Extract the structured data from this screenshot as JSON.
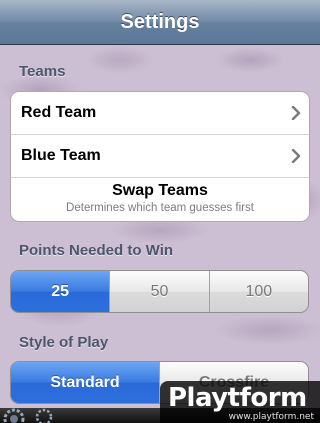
{
  "nav": {
    "title": "Settings"
  },
  "teams": {
    "header": "Teams",
    "red_team_label": "Red Team",
    "blue_team_label": "Blue Team",
    "swap_title": "Swap Teams",
    "swap_subtitle": "Determines which team guesses first"
  },
  "points": {
    "header": "Points Needed to Win",
    "options": [
      "25",
      "50",
      "100"
    ],
    "selected": "25"
  },
  "style": {
    "header": "Style of Play",
    "options": [
      "Standard",
      "Crossfire"
    ],
    "selected": "Standard"
  },
  "watermark": {
    "logo": "Playtform",
    "url": "www.playtform.net"
  },
  "colors": {
    "accent": "#2c6fdc",
    "nav_bar": "#6680a0",
    "background": "#cdbfd3",
    "section_header": "#4c566c"
  },
  "icons": {
    "disclosure": "chevron-right-icon",
    "toolbar": "gear-icon"
  }
}
